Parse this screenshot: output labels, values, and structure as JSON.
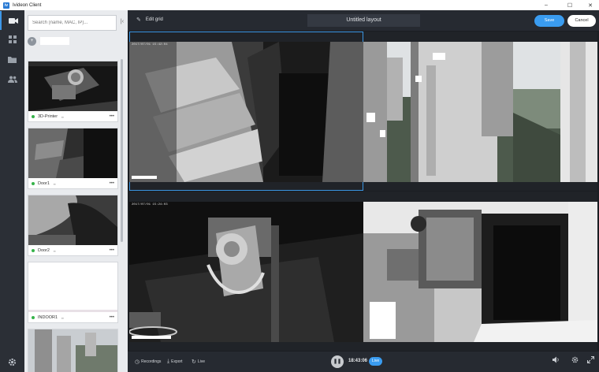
{
  "window": {
    "logo_text": "iv",
    "title": "Ivideon Client",
    "minimize": "–",
    "maximize": "☐",
    "close": "✕"
  },
  "rail": {
    "items": [
      "camera-icon",
      "grid-icon",
      "folder-icon",
      "users-icon"
    ],
    "settings": "gear-icon"
  },
  "panel": {
    "search_placeholder": "Search (name, MAC, IP)...",
    "collapse_glyph": "|‹",
    "group_toggle": "+",
    "cameras": [
      {
        "name": "3D-Printer"
      },
      {
        "name": "Door1"
      },
      {
        "name": "Door2"
      },
      {
        "name": "INDOOR1"
      },
      {
        "name": ""
      }
    ],
    "more_glyph": "•••"
  },
  "toolbar": {
    "edit_label": "Edit grid",
    "layout_title": "Untitled layout",
    "save_label": "Save",
    "cancel_label": "Cancel"
  },
  "tiles": {
    "t1_osd": "2017/07/01  15:42:04",
    "t3_osd": "2017/07/01  15:24:03"
  },
  "bottombar": {
    "recordings_label": "Recordings",
    "export_label": "Export",
    "live_label": "Live",
    "time": "18:43:06",
    "live_badge": "Live",
    "play_glyph": "❚❚"
  }
}
